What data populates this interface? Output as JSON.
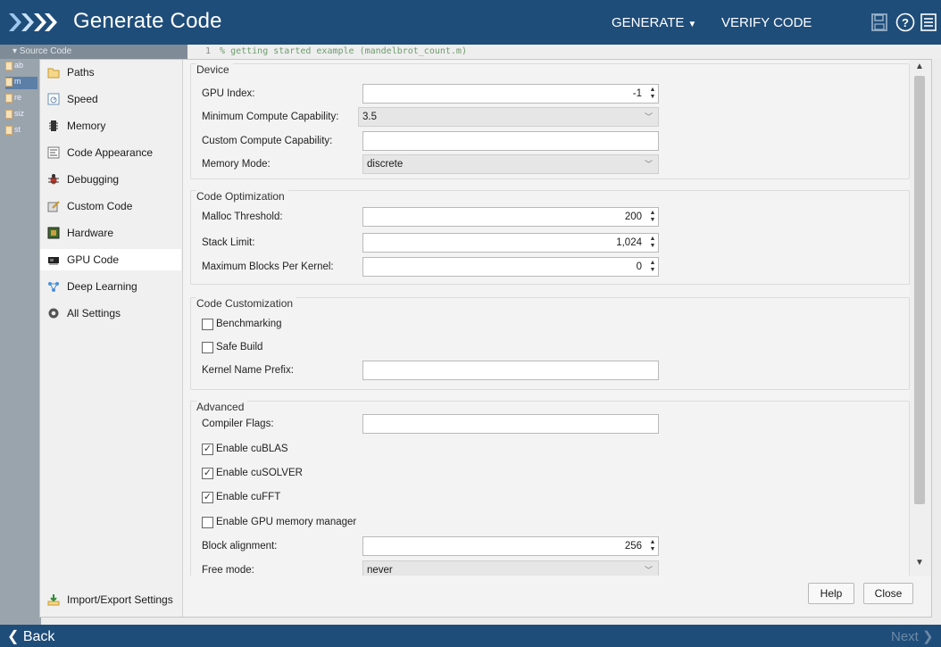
{
  "titlebar": {
    "title": "Generate Code",
    "generate_label": "GENERATE",
    "verify_label": "VERIFY CODE"
  },
  "source": {
    "header": "▾ Source Code",
    "files": [
      "ab",
      "m",
      "re",
      "siz",
      "st"
    ],
    "code_line_number": "1",
    "code_line_text": "% getting started example (mandelbrot_count.m)"
  },
  "nav": {
    "items": [
      {
        "label": "Paths",
        "icon": "folder-icon"
      },
      {
        "label": "Speed",
        "icon": "speed-icon"
      },
      {
        "label": "Memory",
        "icon": "memory-chip-icon"
      },
      {
        "label": "Code Appearance",
        "icon": "code-appearance-icon"
      },
      {
        "label": "Debugging",
        "icon": "bug-icon"
      },
      {
        "label": "Custom Code",
        "icon": "custom-code-icon"
      },
      {
        "label": "Hardware",
        "icon": "hardware-board-icon"
      },
      {
        "label": "GPU Code",
        "icon": "gpu-card-icon"
      },
      {
        "label": "Deep Learning",
        "icon": "network-icon"
      },
      {
        "label": "All Settings",
        "icon": "gear-icon"
      }
    ],
    "active": "GPU Code",
    "import_export": "Import/Export Settings"
  },
  "device": {
    "title": "Device",
    "gpu_index_label": "GPU Index:",
    "gpu_index_value": "-1",
    "min_compute_label": "Minimum Compute Capability:",
    "min_compute_value": "3.5",
    "custom_compute_label": "Custom Compute Capability:",
    "custom_compute_value": "",
    "memory_mode_label": "Memory Mode:",
    "memory_mode_value": "discrete"
  },
  "optimization": {
    "title": "Code Optimization",
    "malloc_label": "Malloc Threshold:",
    "malloc_value": "200",
    "stack_label": "Stack Limit:",
    "stack_value": "1,024",
    "max_blocks_label": "Maximum Blocks Per Kernel:",
    "max_blocks_value": "0"
  },
  "customization": {
    "title": "Code Customization",
    "benchmarking_label": "Benchmarking",
    "benchmarking_checked": false,
    "safe_build_label": "Safe Build",
    "safe_build_checked": false,
    "kernel_prefix_label": "Kernel Name Prefix:",
    "kernel_prefix_value": ""
  },
  "advanced": {
    "title": "Advanced",
    "compiler_flags_label": "Compiler Flags:",
    "compiler_flags_value": "",
    "cublas_label": "Enable cuBLAS",
    "cublas_checked": true,
    "cusolver_label": "Enable cuSOLVER",
    "cusolver_checked": true,
    "cufft_label": "Enable cuFFT",
    "cufft_checked": true,
    "memmgr_label": "Enable GPU memory manager",
    "memmgr_checked": false,
    "block_align_label": "Block alignment:",
    "block_align_value": "256",
    "free_mode_label": "Free mode:",
    "free_mode_value": "never"
  },
  "buttons": {
    "help": "Help",
    "close": "Close"
  },
  "bottombar": {
    "back": "Back",
    "next": "Next"
  },
  "colors": {
    "titlebar_bg": "#1f4d7a",
    "dialog_bg": "#f3f3f3",
    "active_nav_bg": "#ffffff"
  }
}
